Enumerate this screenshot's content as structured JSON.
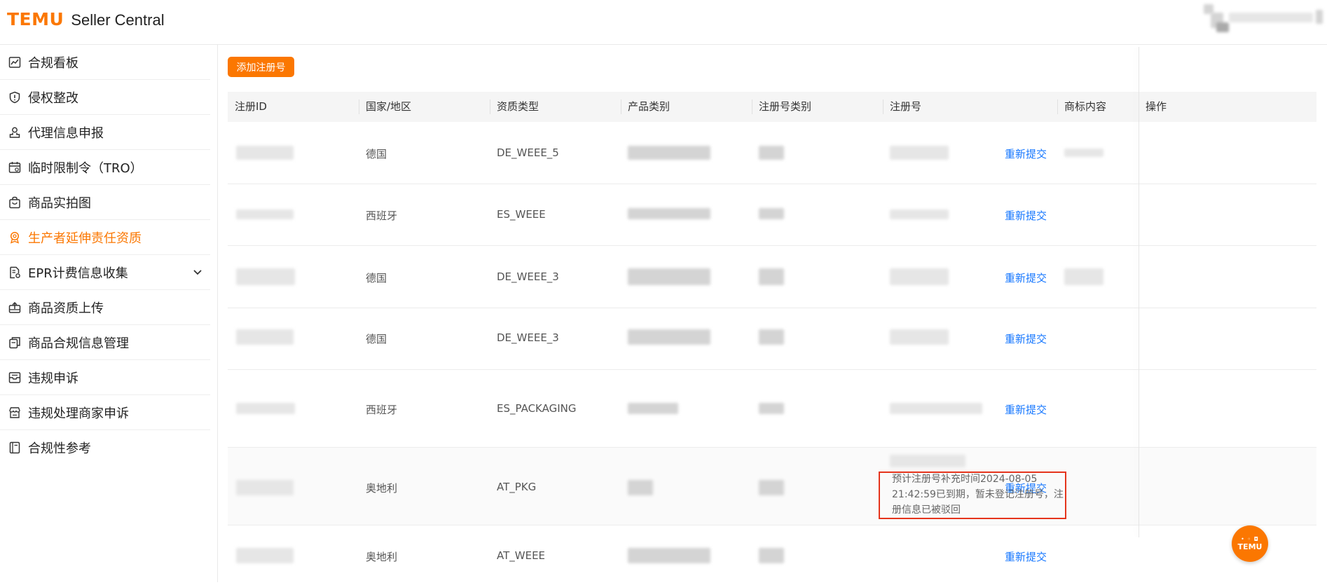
{
  "header": {
    "logo_brand": "TEMU",
    "logo_product": "Seller Central"
  },
  "sidebar": {
    "items": [
      {
        "label": "合规看板",
        "icon": "chart-line-icon"
      },
      {
        "label": "侵权整改",
        "icon": "shield-alert-icon"
      },
      {
        "label": "代理信息申报",
        "icon": "user-stamp-icon"
      },
      {
        "label": "临时限制令（TRO）",
        "icon": "calendar-icon"
      },
      {
        "label": "商品实拍图",
        "icon": "shopping-bag-icon"
      },
      {
        "label": "生产者延伸责任资质",
        "icon": "badge-icon",
        "active": true
      },
      {
        "label": "EPR计费信息收集",
        "icon": "document-settings-icon",
        "expandable": true
      },
      {
        "label": "商品资质上传",
        "icon": "upload-tray-icon"
      },
      {
        "label": "商品合规信息管理",
        "icon": "copy-docs-icon"
      },
      {
        "label": "违规申诉",
        "icon": "inbox-icon"
      },
      {
        "label": "违规处理商家申诉",
        "icon": "store-icon"
      },
      {
        "label": "合规性参考",
        "icon": "book-icon"
      }
    ]
  },
  "toolbar": {
    "add_label": "添加注册号"
  },
  "table": {
    "columns": [
      "注册ID",
      "国家/地区",
      "资质类型",
      "产品类别",
      "注册号类别",
      "注册号",
      "商标内容",
      "操作"
    ],
    "rows": [
      {
        "country": "德国",
        "type": "DE_WEEE_5",
        "action": "重新提交"
      },
      {
        "country": "西班牙",
        "type": "ES_WEEE",
        "action": "重新提交"
      },
      {
        "country": "德国",
        "type": "DE_WEEE_3",
        "action": "重新提交"
      },
      {
        "country": "德国",
        "type": "DE_WEEE_3",
        "action": "重新提交"
      },
      {
        "country": "西班牙",
        "type": "ES_PACKAGING",
        "action": "重新提交"
      },
      {
        "country": "奥地利",
        "type": "AT_PKG",
        "action": "重新提交",
        "note": "预计注册号补充时间2024-08-05 21:42:59已到期，暂未登记注册号，注册信息已被驳回"
      },
      {
        "country": "奥地利",
        "type": "AT_WEEE",
        "action": "重新提交"
      }
    ]
  },
  "float_button": {
    "label": "TEMU"
  },
  "colors": {
    "brand": "#fb7701",
    "link": "#1677ff",
    "alert": "#e5341c"
  }
}
